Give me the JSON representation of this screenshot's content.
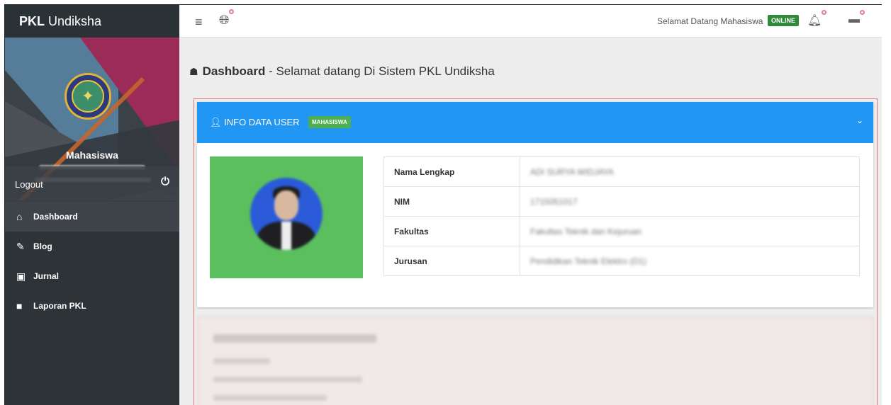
{
  "brand": {
    "bold": "PKL",
    "rest": " Undiksha"
  },
  "sidebar": {
    "user_role": "Mahasiswa",
    "logout_label": "Logout",
    "items": [
      {
        "icon": "home-icon",
        "label": "Dashboard",
        "active": true
      },
      {
        "icon": "pencil-icon",
        "label": "Blog",
        "active": false
      },
      {
        "icon": "save-icon",
        "label": "Jurnal",
        "active": false
      },
      {
        "icon": "book-icon",
        "label": "Laporan PKL",
        "active": false
      }
    ]
  },
  "header": {
    "welcome": "Selamat Datang Mahasiswa",
    "status": "ONLINE",
    "status_color": "#2e8b3a"
  },
  "page": {
    "title_bold": "Dashboard",
    "title_rest": " - Selamat datang Di Sistem PKL Undiksha"
  },
  "card": {
    "title": "INFO DATA USER",
    "badge": "MAHASISWA",
    "accent": "#2196f3",
    "rows": [
      {
        "label": "Nama Lengkap",
        "value": "ADI SURYA WIDJAYA"
      },
      {
        "label": "NIM",
        "value": "1715051017"
      },
      {
        "label": "Fakultas",
        "value": "Fakultas Teknik dan Kejuruan"
      },
      {
        "label": "Jurusan",
        "value": "Pendidikan Teknik Elektro (D1)"
      }
    ]
  }
}
